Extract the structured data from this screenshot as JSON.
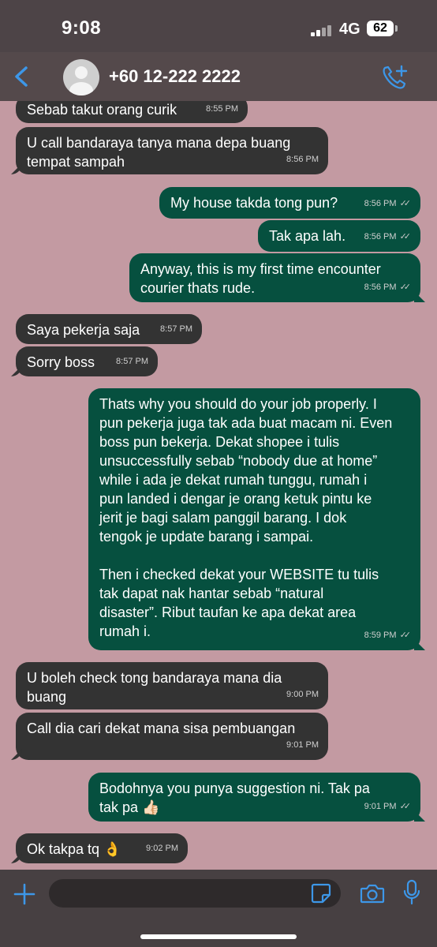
{
  "status_bar": {
    "time": "9:08",
    "network": "4G",
    "battery": "62"
  },
  "header": {
    "contact": "+60 12-222 2222"
  },
  "messages": [
    {
      "dir": "in",
      "text": "Sebab takut orang curik",
      "time": "8:55 PM"
    },
    {
      "dir": "in",
      "text": "U call bandaraya tanya mana depa buang\ntempat sampah",
      "time": "8:56 PM"
    },
    {
      "dir": "out",
      "text": "My house takda tong pun?",
      "time": "8:56 PM"
    },
    {
      "dir": "out",
      "text": "Tak apa lah.",
      "time": "8:56 PM"
    },
    {
      "dir": "out",
      "text": "Anyway, this is my first time encounter\ncourier thats rude.",
      "time": "8:56 PM"
    },
    {
      "dir": "in",
      "text": "Saya pekerja saja",
      "time": "8:57 PM"
    },
    {
      "dir": "in",
      "text": "Sorry boss",
      "time": "8:57 PM"
    },
    {
      "dir": "out",
      "text": "Thats why you should do your job properly. I\npun pekerja juga tak ada buat macam ni. Even\nboss pun bekerja. Dekat shopee i tulis\nunsuccessfully sebab “nobody due at home”\nwhile i ada je dekat rumah tunggu, rumah i\npun landed i dengar je orang ketuk pintu ke\njerit je bagi salam panggil barang. I dok\ntengok je update barang i sampai.\n\nThen i checked dekat your WEBSITE tu tulis\ntak dapat nak hantar sebab “natural\ndisaster”. Ribut taufan ke apa dekat area\nrumah i.",
      "time": "8:59 PM"
    },
    {
      "dir": "in",
      "text": "U boleh check tong bandaraya mana dia\nbuang",
      "time": "9:00 PM"
    },
    {
      "dir": "in",
      "text": "Call dia cari dekat mana sisa pembuangan",
      "time": "9:01 PM"
    },
    {
      "dir": "out",
      "text": "Bodohnya you punya suggestion ni. Tak pa\ntak pa 👍🏻",
      "time": "9:01 PM"
    },
    {
      "dir": "in",
      "text": "Ok takpa tq 👌",
      "time": "9:02 PM"
    }
  ],
  "icons": {
    "back": "chevron-left-icon",
    "avatar": "person-icon",
    "call": "phone-plus-icon",
    "attach": "plus-icon",
    "sticker": "sticker-icon",
    "camera": "camera-icon",
    "mic": "microphone-icon"
  },
  "colors": {
    "chat_background": "#c39aa2",
    "incoming_bubble": "#333333",
    "outgoing_bubble": "#06503f",
    "accent": "#3d97e8"
  }
}
